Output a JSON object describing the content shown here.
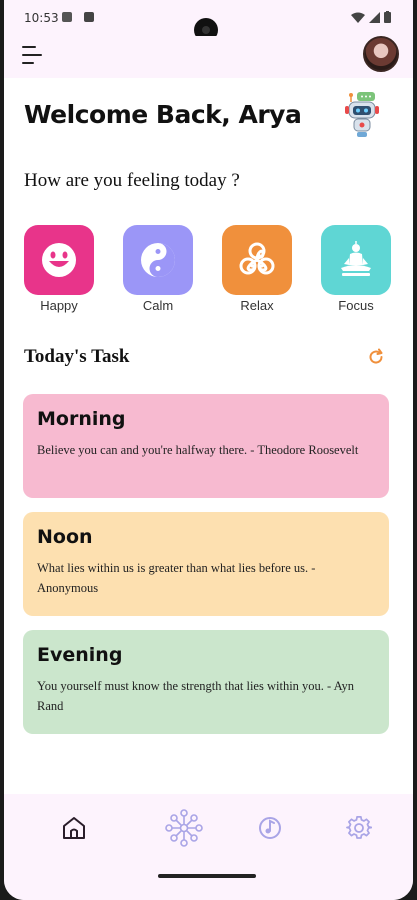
{
  "status_bar": {
    "time": "10:53"
  },
  "greeting": "Welcome Back, Arya",
  "feeling_prompt": "How are you feeling today ?",
  "moods": [
    {
      "label": "Happy",
      "color": "#e8348a",
      "icon": "smiley-icon"
    },
    {
      "label": "Calm",
      "color": "#9b96f7",
      "icon": "yin-yang-icon"
    },
    {
      "label": "Relax",
      "color": "#f0903c",
      "icon": "triskele-icon"
    },
    {
      "label": "Focus",
      "color": "#5fd6d4",
      "icon": "meditation-icon"
    }
  ],
  "tasks_heading": "Today's Task",
  "tasks": [
    {
      "title": "Morning",
      "quote": "Believe you can and you're halfway there. - Theodore Roosevelt",
      "color": "#f7bad0"
    },
    {
      "title": "Noon",
      "quote": "What lies within us is greater than what lies before us. - Anonymous",
      "color": "#fde0b0"
    },
    {
      "title": "Evening",
      "quote": "You yourself must know the strength that lies within you. - Ayn Rand",
      "color": "#cbe6cc"
    }
  ],
  "bottom_nav": [
    {
      "icon": "home-icon",
      "active": true
    },
    {
      "icon": "network-icon",
      "active": false
    },
    {
      "icon": "music-icon",
      "active": false
    },
    {
      "icon": "settings-icon",
      "active": false
    }
  ],
  "colors": {
    "accent": "#f0903c",
    "nav_inactive": "#a9a4e6",
    "background": "#fdf3fd"
  }
}
